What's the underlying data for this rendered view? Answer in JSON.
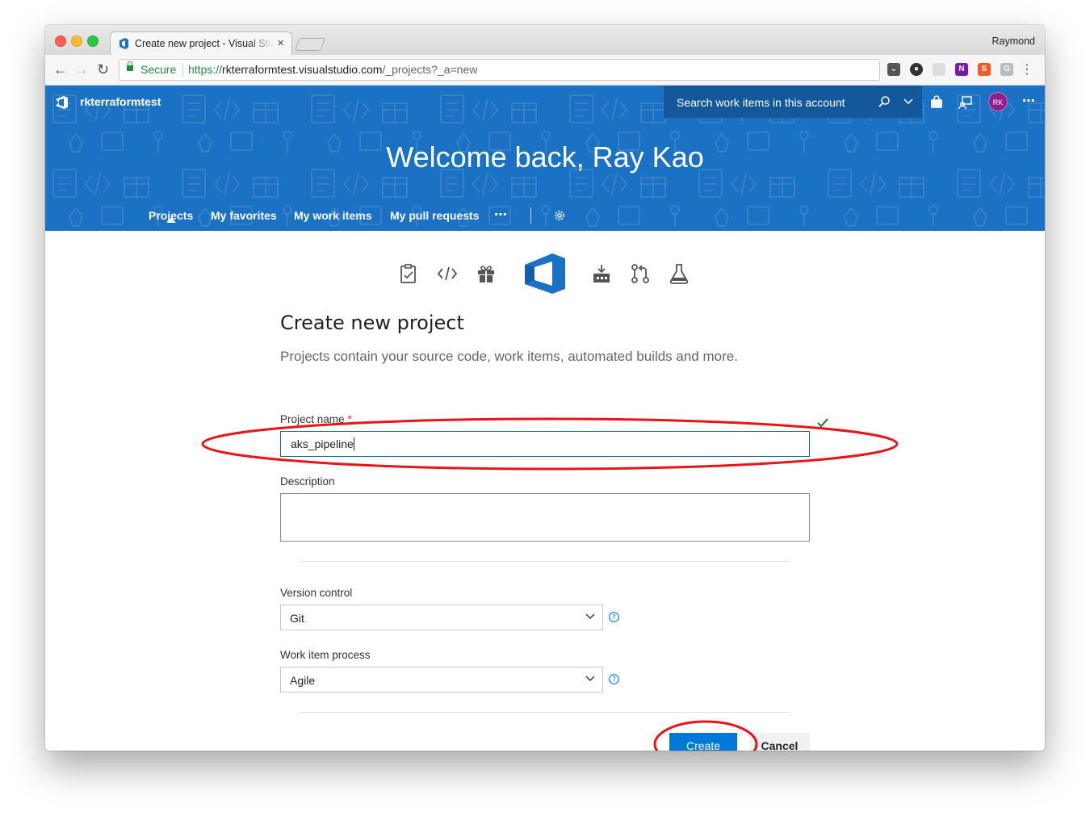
{
  "browser": {
    "tab_title": "Create new project - Visual Studio",
    "profile_name": "Raymond",
    "secure_label": "Secure",
    "url_scheme": "https://",
    "url_host": "rkterraformtest.visualstudio.com",
    "url_path": "/_projects?_a=new"
  },
  "header": {
    "account_name": "rkterraformtest",
    "search_placeholder": "Search work items in this account",
    "avatar_initials": "RK",
    "welcome": "Welcome back, Ray Kao",
    "more_label": "⋯"
  },
  "nav": {
    "items": [
      {
        "label": "Projects",
        "active": true
      },
      {
        "label": "My favorites",
        "active": false
      },
      {
        "label": "My work items",
        "active": false
      },
      {
        "label": "My pull requests",
        "active": false
      }
    ],
    "more_label": "⋯"
  },
  "form": {
    "title": "Create new project",
    "subtitle": "Projects contain your source code, work items, automated builds and more.",
    "project_name_label": "Project name",
    "required_marker": "*",
    "project_name_value": "aks_pipeline",
    "description_label": "Description",
    "description_value": "",
    "version_control_label": "Version control",
    "version_control_value": "Git",
    "work_item_process_label": "Work item process",
    "work_item_process_value": "Agile",
    "create_label": "Create",
    "cancel_label": "Cancel"
  },
  "colors": {
    "banner": "#1b72c4",
    "search_bg": "#13589a",
    "primary_button": "#0078d7",
    "annotation_red": "#e8141a",
    "valid_check": "#107c10"
  }
}
